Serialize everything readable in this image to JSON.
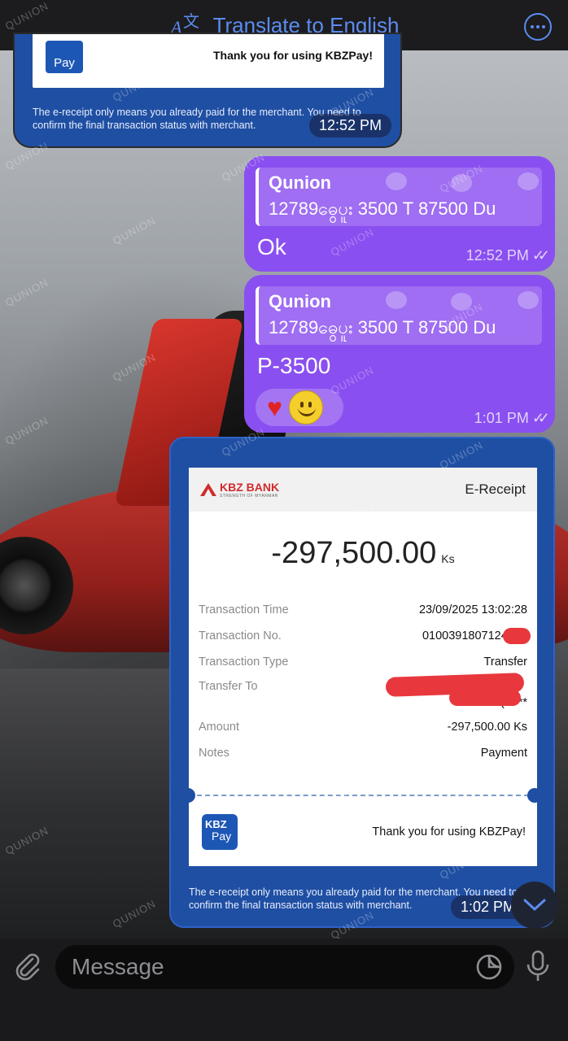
{
  "header": {
    "translate_label": "Translate to English",
    "icon_translate": "translate-icon",
    "icon_more": "more-icon"
  },
  "watermark": "QUNION",
  "messages": [
    {
      "type": "incoming-receipt-partial",
      "card_logo": "Pay",
      "card_thanks": "Thank you for using KBZPay!",
      "note": "The e-receipt only means you already paid for the merchant. You need to confirm the final transaction status with merchant.",
      "time": "12:52 PM"
    },
    {
      "type": "outgoing",
      "reply_name": "Qunion",
      "reply_text": "12789ဓွေပူး 3500 T 87500 Du",
      "text": "Ok",
      "time": "12:52 PM",
      "read": true
    },
    {
      "type": "outgoing",
      "reply_name": "Qunion",
      "reply_text": "12789ဓွေပူး 3500 T 87500 Du",
      "text": "P-3500",
      "reactions": [
        "heart",
        "smiley"
      ],
      "time": "1:01 PM",
      "read": true
    },
    {
      "type": "incoming-receipt",
      "bank_name": "KBZ BANK",
      "bank_tagline": "STRENGTH OF MYANMAR",
      "receipt_title": "E-Receipt",
      "amount": "-297,500.00",
      "amount_unit": "Ks",
      "rows": [
        {
          "label": "Transaction Time",
          "value": "23/09/2025 13:02:28"
        },
        {
          "label": "Transaction No.",
          "value": "0100391807124218"
        },
        {
          "label": "Transaction Type",
          "value": "Transfer"
        },
        {
          "label": "Transfer To",
          "value": "(*****"
        },
        {
          "label": "Amount",
          "value": "-297,500.00 Ks"
        },
        {
          "label": "Notes",
          "value": "Payment"
        }
      ],
      "logo_top": "KBZ",
      "logo_bottom": "Pay",
      "thanks": "Thank you for using KBZPay!",
      "note": "The e-receipt only means you already paid for the merchant. You need to confirm the final transaction status with merchant.",
      "time": "1:02 PM"
    }
  ],
  "composer": {
    "placeholder": "Message",
    "icon_attach": "paperclip-icon",
    "icon_sticker": "sticker-icon",
    "icon_mic": "microphone-icon"
  },
  "colors": {
    "accent": "#5b8cf0",
    "outgoing_bubble": "#8a4ff0",
    "incoming_bubble": "#1f4fa3",
    "redaction": "#e8383d",
    "kbz_red": "#d12c2c"
  }
}
